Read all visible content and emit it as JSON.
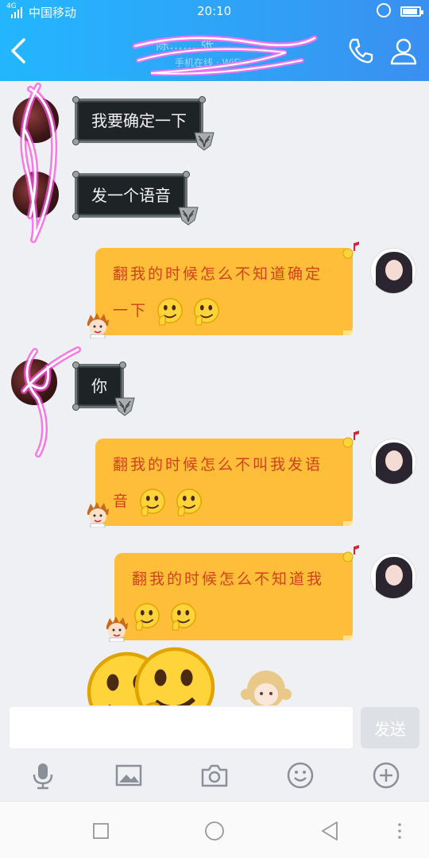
{
  "status_bar": {
    "network": "4G",
    "carrier": "中国移动",
    "time": "20:10"
  },
  "header": {
    "title": "陈…… 张……",
    "subtitle": "手机在线 · WiFi",
    "back_icon": "chevron-left-icon",
    "call_icon": "phone-icon",
    "profile_icon": "user-icon"
  },
  "messages": [
    {
      "side": "left",
      "style": "dark",
      "text": "我要确定一下"
    },
    {
      "side": "left",
      "style": "dark",
      "text": "发一个语音"
    },
    {
      "side": "right",
      "style": "orange",
      "line1": "翻我的时候怎么不知道确定",
      "line2": "一下"
    },
    {
      "side": "left",
      "style": "dark",
      "text": "你"
    },
    {
      "side": "right",
      "style": "orange",
      "line1": "翻我的时候怎么不叫我发语",
      "line2": "音"
    },
    {
      "side": "right",
      "style": "orange",
      "line1": "翻我的时候怎么不知道我",
      "line2": ""
    }
  ],
  "composer": {
    "input_value": "",
    "send_label": "发送"
  },
  "toolbar": [
    "microphone-icon",
    "image-icon",
    "camera-icon",
    "emoji-icon",
    "plus-icon"
  ],
  "nav": [
    "recent-apps-icon",
    "home-icon",
    "back-icon",
    "more-icon"
  ],
  "colors": {
    "header": "#2fa3f7",
    "orange_bubble": "#ffbe3a",
    "orange_text": "#d2421a",
    "dark_bubble": "#1e2326",
    "neon": "#ff4fe0"
  }
}
